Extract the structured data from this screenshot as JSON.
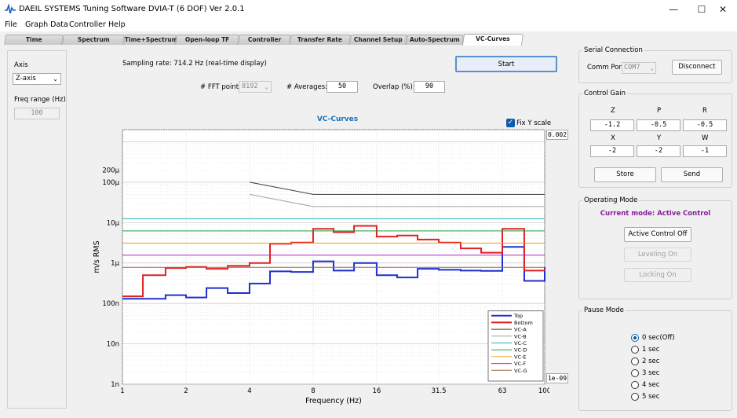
{
  "window": {
    "title": "DAEIL SYSTEMS Tuning Software DVIA-T (6 DOF) Ver 2.0.1",
    "minimize": "—",
    "maximize": "☐",
    "close": "✕"
  },
  "menu": [
    "File",
    "Graph Data",
    "Controller",
    "Help"
  ],
  "tabs": [
    "Time",
    "Spectrum",
    "Time+Spectrum",
    "Open-loop TF",
    "Controller",
    "Transfer Rate",
    "Channel Setup",
    "Auto-Spectrum",
    "VC-Curves"
  ],
  "active_tab": "VC-Curves",
  "left": {
    "axis_label": "Axis",
    "axis_value": "Z-axis",
    "freq_label": "Freq range (Hz)",
    "freq_value": "100"
  },
  "top": {
    "sampling": "Sampling rate: 714.2 Hz (real-time display)",
    "start": "Start",
    "fft_label": "# FFT points:",
    "fft_value": "8192",
    "avg_label": "# Averages:",
    "avg_value": "50",
    "overlap_label": "Overlap (%):",
    "overlap_value": "90"
  },
  "plot": {
    "fix_y_label": "Fix Y scale",
    "ymax_value": "0.002",
    "ymin_value": "1e-09"
  },
  "serial": {
    "title": "Serial Connection",
    "comm_label": "Comm Port",
    "comm_value": "COM7",
    "disconnect": "Disconnect"
  },
  "gain": {
    "title": "Control Gain",
    "labels": [
      "Z",
      "P",
      "R",
      "X",
      "Y",
      "W"
    ],
    "values": [
      "-1.2",
      "-0.5",
      "-0.5",
      "-2",
      "-2",
      "-1"
    ],
    "store": "Store",
    "send": "Send"
  },
  "mode": {
    "title": "Operating Mode",
    "current": "Current mode: Active Control",
    "active_off": "Active Control Off",
    "leveling": "Leveling On",
    "locking": "Locking On"
  },
  "pause": {
    "title": "Pause Mode",
    "options": [
      "0 sec(Off)",
      "1 sec",
      "2 sec",
      "3 sec",
      "4 sec",
      "5 sec"
    ],
    "selected": 0
  },
  "colors": {
    "top": "#1f2fcf",
    "bottom": "#e02020",
    "accent": "#0b5cad",
    "mode_text": "#8a1a9e"
  },
  "chart_data": {
    "type": "line",
    "title": "VC-Curves",
    "xlabel": "Frequency (Hz)",
    "ylabel": "m/s RMS",
    "xscale": "log",
    "yscale": "log",
    "xlim": [
      1,
      100
    ],
    "ylim": [
      1e-09,
      0.002
    ],
    "xticks": [
      1,
      2,
      4,
      8,
      16,
      31.5,
      63,
      100
    ],
    "xtick_labels": [
      "1",
      "2",
      "4",
      "8",
      "16",
      "31.5",
      "63",
      "100"
    ],
    "yticks": [
      1e-09,
      1e-08,
      1e-07,
      1e-06,
      1e-05,
      0.0001,
      0.0002
    ],
    "ytick_labels": [
      "1n",
      "10n",
      "100n",
      "1µ",
      "10µ",
      "100µ",
      "200µ"
    ],
    "grid": true,
    "legend_position": "bottom-right",
    "series": [
      {
        "name": "Top",
        "color": "#1f2fcf",
        "width": 2,
        "step": true,
        "x": [
          1,
          1.25,
          1.6,
          2,
          2.5,
          3.15,
          4,
          5,
          6.3,
          8,
          10,
          12.5,
          16,
          20,
          25,
          31.5,
          40,
          50,
          63,
          80,
          100
        ],
        "y": [
          1.3e-07,
          1.3e-07,
          1.6e-07,
          1.4e-07,
          2.4e-07,
          1.8e-07,
          3.1e-07,
          6.2e-07,
          6e-07,
          1.1e-06,
          6.5e-07,
          1e-06,
          5e-07,
          4.4e-07,
          7.2e-07,
          6.8e-07,
          6.5e-07,
          6.4e-07,
          2.5e-06,
          3.6e-07,
          8e-07
        ]
      },
      {
        "name": "Bottom",
        "color": "#e02020",
        "width": 2,
        "step": true,
        "x": [
          1,
          1.25,
          1.6,
          2,
          2.5,
          3.15,
          4,
          5,
          6.3,
          8,
          10,
          12.5,
          16,
          20,
          25,
          31.5,
          40,
          50,
          63,
          80,
          100
        ],
        "y": [
          1.5e-07,
          5e-07,
          7.5e-07,
          8e-07,
          7.2e-07,
          8.5e-07,
          1e-06,
          3e-06,
          3.2e-06,
          7e-06,
          5.8e-06,
          8.3e-06,
          4.5e-06,
          4.8e-06,
          3.8e-06,
          3.2e-06,
          2.3e-06,
          1.8e-06,
          7e-06,
          6.5e-07,
          7e-07
        ]
      },
      {
        "name": "VC-A",
        "color": "#3a3a3a",
        "width": 1,
        "step": false,
        "x": [
          4,
          8,
          100
        ],
        "y": [
          0.0001,
          5e-05,
          5e-05
        ]
      },
      {
        "name": "VC-B",
        "color": "#a0a0a0",
        "width": 1,
        "step": false,
        "x": [
          4,
          8,
          100
        ],
        "y": [
          5e-05,
          2.5e-05,
          2.5e-05
        ]
      },
      {
        "name": "VC-C",
        "color": "#26b0b0",
        "width": 1,
        "step": false,
        "x": [
          1,
          100
        ],
        "y": [
          1.25e-05,
          1.25e-05
        ]
      },
      {
        "name": "VC-D",
        "color": "#22a23a",
        "width": 1,
        "step": false,
        "x": [
          1,
          100
        ],
        "y": [
          6.25e-06,
          6.25e-06
        ]
      },
      {
        "name": "VC-E",
        "color": "#f0a020",
        "width": 1,
        "step": false,
        "x": [
          1,
          100
        ],
        "y": [
          3.12e-06,
          3.12e-06
        ]
      },
      {
        "name": "VC-F",
        "color": "#b020c0",
        "width": 1,
        "step": false,
        "x": [
          1,
          100
        ],
        "y": [
          1.56e-06,
          1.56e-06
        ]
      },
      {
        "name": "VC-G",
        "color": "#9a6a3a",
        "width": 1,
        "step": false,
        "x": [
          1,
          100
        ],
        "y": [
          7.8e-07,
          7.8e-07
        ]
      }
    ]
  }
}
